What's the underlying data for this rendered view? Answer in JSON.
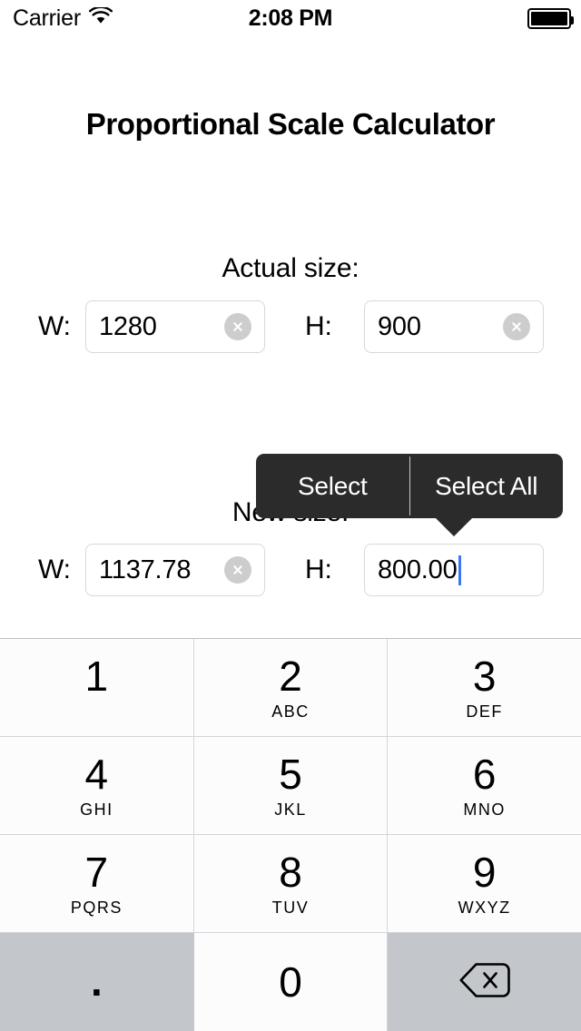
{
  "status_bar": {
    "carrier": "Carrier",
    "wifi_icon": "wifi-icon",
    "time": "2:08 PM",
    "battery_icon": "battery-icon"
  },
  "header": {
    "title": "Proportional Scale Calculator"
  },
  "sections": {
    "actual": {
      "label": "Actual size:",
      "width_label": "W:",
      "width_value": "1280",
      "height_label": "H:",
      "height_value": "900",
      "clear_icon": "clear-circle-icon"
    },
    "new": {
      "label": "New size:",
      "width_label": "W:",
      "width_value": "1137.78",
      "height_label": "H:",
      "height_value": "800.00",
      "clear_icon": "clear-circle-icon"
    }
  },
  "select_menu": {
    "select_label": "Select",
    "select_all_label": "Select All",
    "background_color": "#2b2b2b",
    "text_color": "#ffffff"
  },
  "keypad": {
    "rows": [
      [
        {
          "digit": "1",
          "letters": ""
        },
        {
          "digit": "2",
          "letters": "ABC"
        },
        {
          "digit": "3",
          "letters": "DEF"
        }
      ],
      [
        {
          "digit": "4",
          "letters": "GHI"
        },
        {
          "digit": "5",
          "letters": "JKL"
        },
        {
          "digit": "6",
          "letters": "MNO"
        }
      ],
      [
        {
          "digit": "7",
          "letters": "PQRS"
        },
        {
          "digit": "8",
          "letters": "TUV"
        },
        {
          "digit": "9",
          "letters": "WXYZ"
        }
      ]
    ],
    "bottom_row": {
      "decimal": ".",
      "zero": "0",
      "backspace_icon": "backspace-delete-icon"
    },
    "key_background": "#fcfcfc",
    "gray_key_background": "#c3c6cb"
  },
  "colors": {
    "caret": "#3a77f5",
    "field_border": "#d8d8d8",
    "clear_button": "#cdcdcd"
  }
}
